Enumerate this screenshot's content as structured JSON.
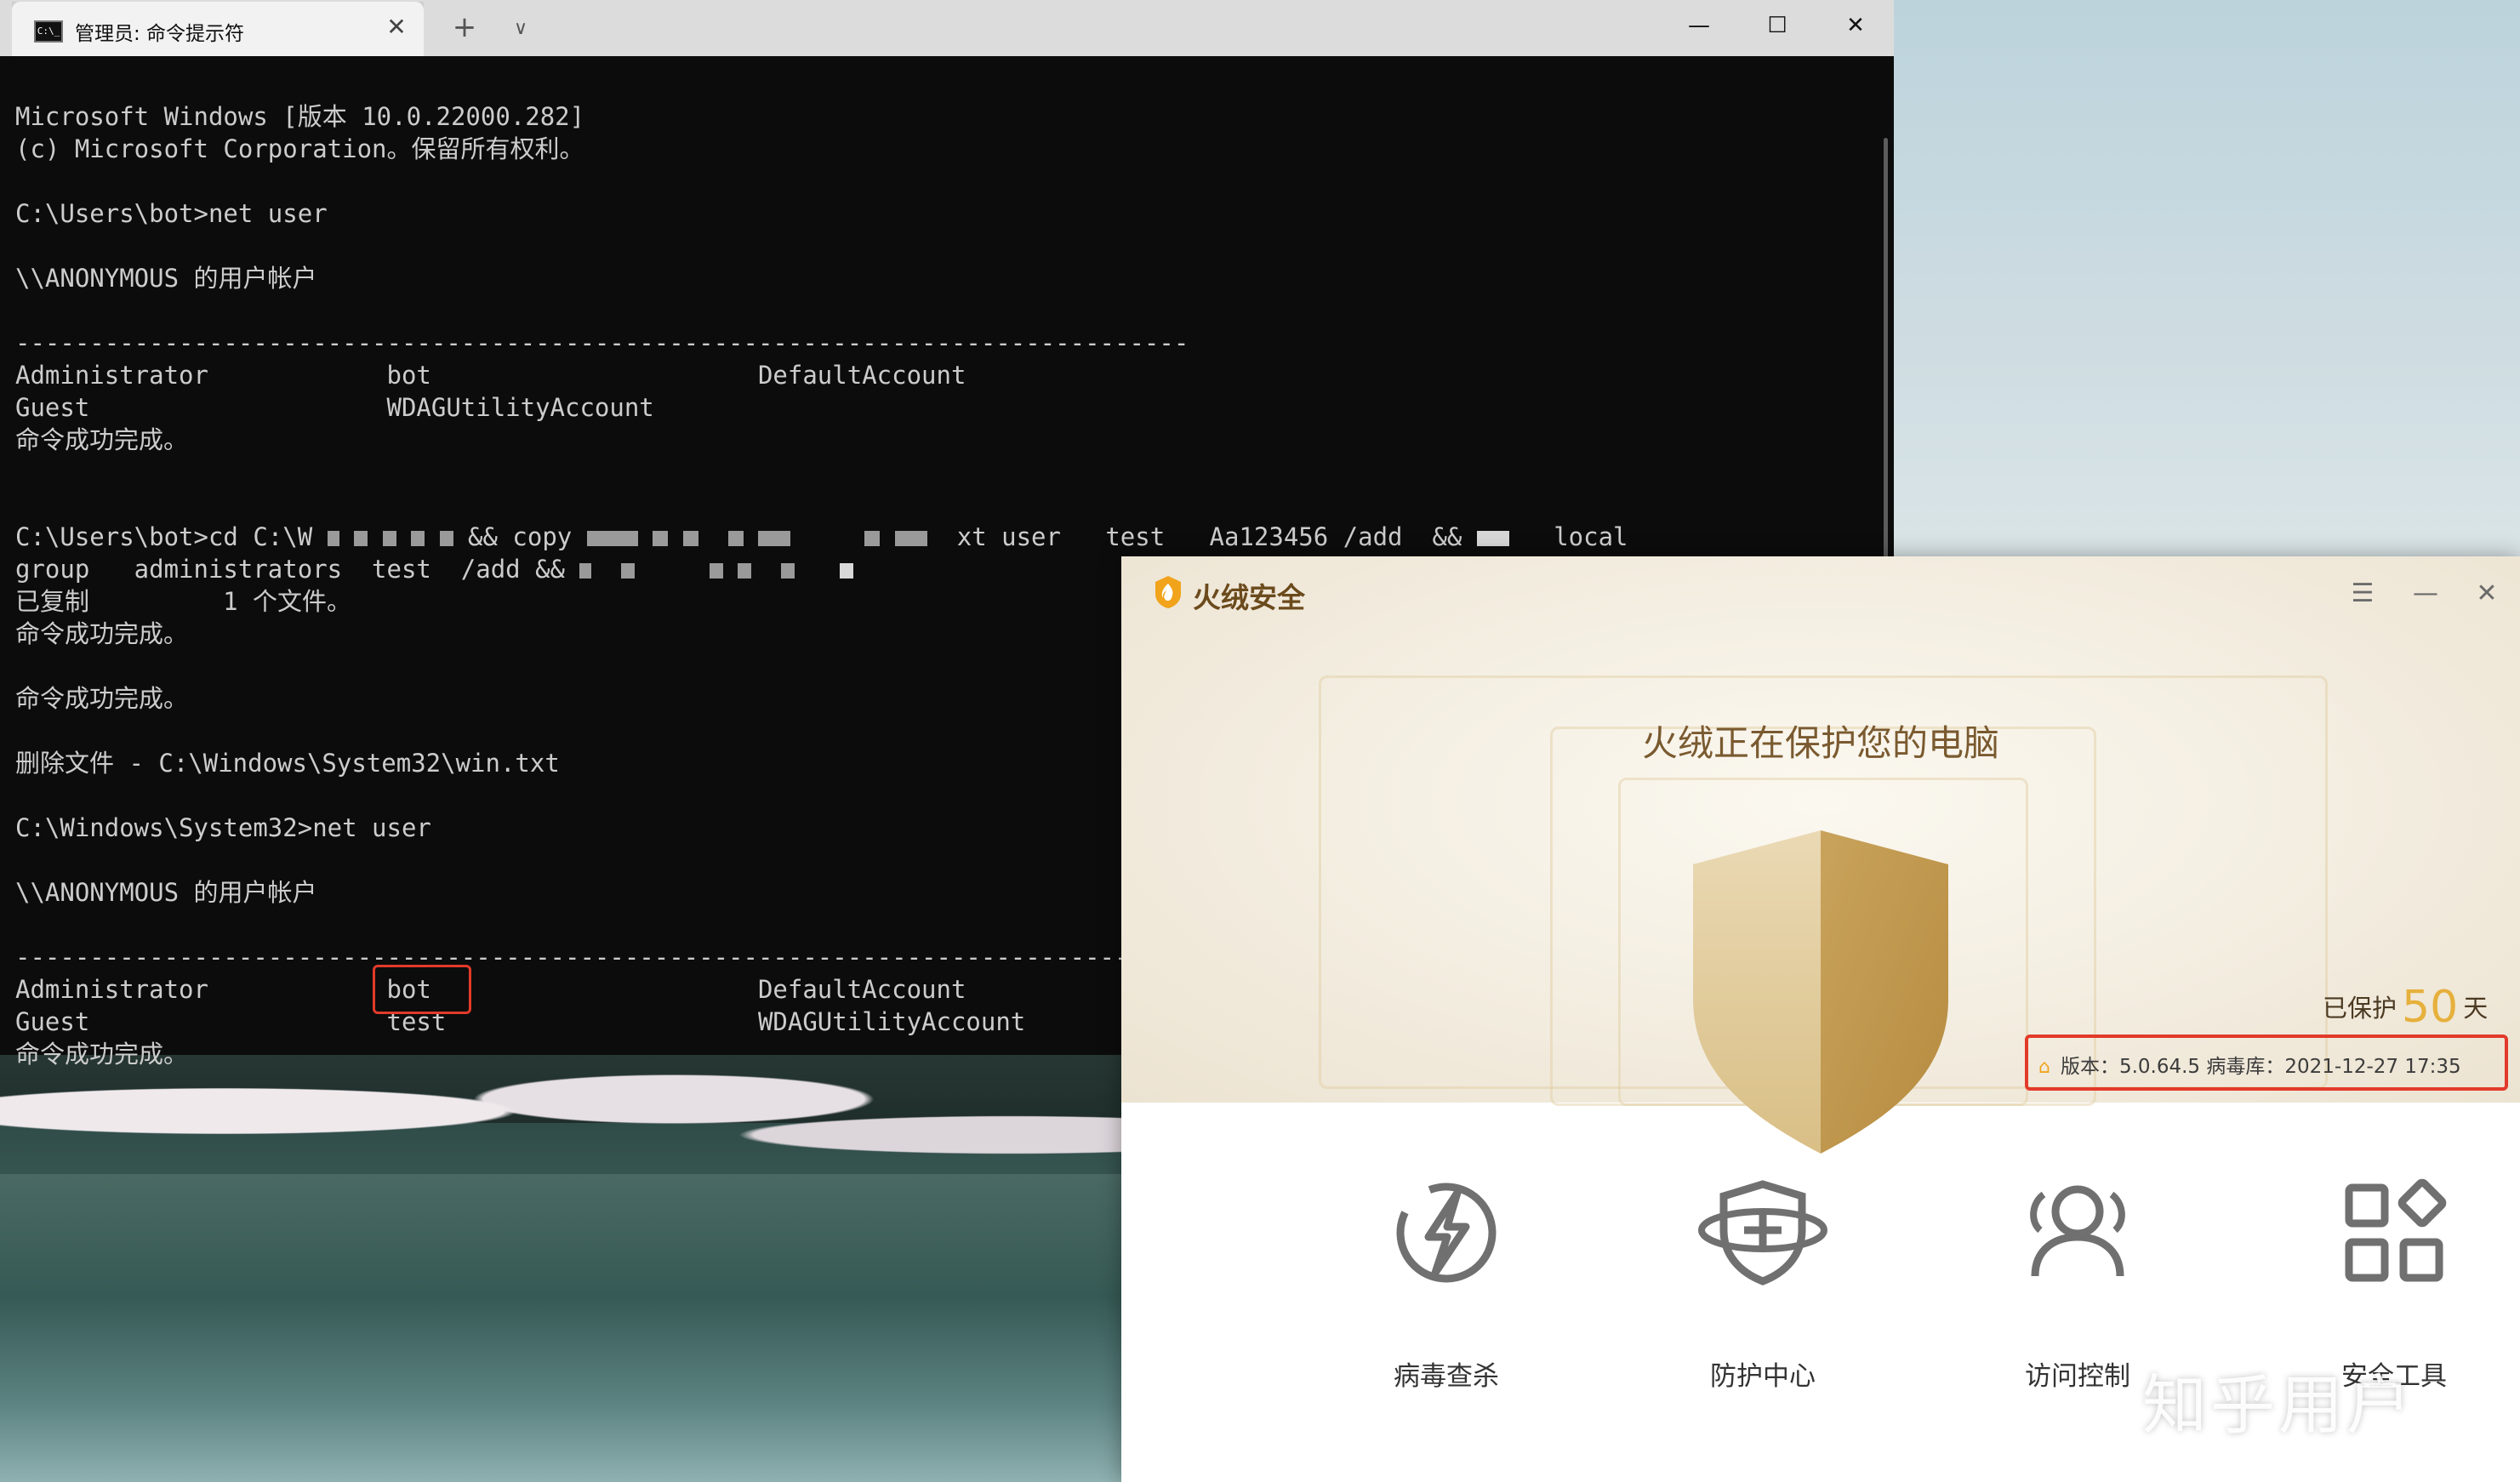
{
  "cmd_window": {
    "tab_title": "管理员: 命令提示符",
    "tab_icon": "cmd-icon",
    "tab_icon_glyph": "C:\\_",
    "close_tab_glyph": "✕",
    "new_tab_glyph": "+",
    "dropdown_glyph": "∨",
    "minimize_glyph": "—",
    "maximize_glyph": "☐",
    "close_glyph": "✕",
    "lines": [
      "Microsoft Windows [版本 10.0.22000.282]",
      "(c) Microsoft Corporation。保留所有权利。",
      "",
      "C:\\Users\\bot>net user",
      "",
      "\\\\ANONYMOUS 的用户帐户",
      "",
      "-------------------------------------------------------------------------------",
      "Administrator            bot                      DefaultAccount",
      "Guest                    WDAGUtilityAccount",
      "命令成功完成。",
      "",
      "",
      "C:\\Users\\bot>cd C:\\W",
      "group   administrators  test  /add &&",
      "已复制         1 个文件。",
      "命令成功完成。",
      "",
      "命令成功完成。",
      "",
      "删除文件 - C:\\Windows\\System32\\win.txt",
      "",
      "C:\\Windows\\System32>net user",
      "",
      "\\\\ANONYMOUS 的用户帐户",
      "",
      "-------------------------------------------------------------------------------",
      "Administrator            bot                      DefaultAccount",
      "Guest                    test                     WDAGUtilityAccount",
      "命令成功完成。"
    ],
    "cd_line_parts": {
      "copy": "&& copy",
      "cmd_tail": "xt user   test   Aa123456 /add  &&",
      "local": "local"
    }
  },
  "security_app": {
    "brand": "火绒安全",
    "menu_glyph": "☰",
    "minimize_glyph": "—",
    "close_glyph": "✕",
    "headline": "火绒正在保护您的电脑",
    "protected_prefix": "已保护",
    "protected_days": "50",
    "protected_suffix": "天",
    "version_line": "版本：5.0.64.5   病毒库：2021-12-27 17:35",
    "upgrade_glyph": "⌂",
    "features": [
      {
        "label": "病毒查杀",
        "icon": "lightning-icon"
      },
      {
        "label": "防护中心",
        "icon": "shield-plus-icon"
      },
      {
        "label": "访问控制",
        "icon": "users-icon"
      },
      {
        "label": "安全工具",
        "icon": "apps-grid-icon"
      }
    ],
    "accent": "#e6b03c",
    "highlight": "#e23a2a"
  },
  "watermark": "知乎用户"
}
